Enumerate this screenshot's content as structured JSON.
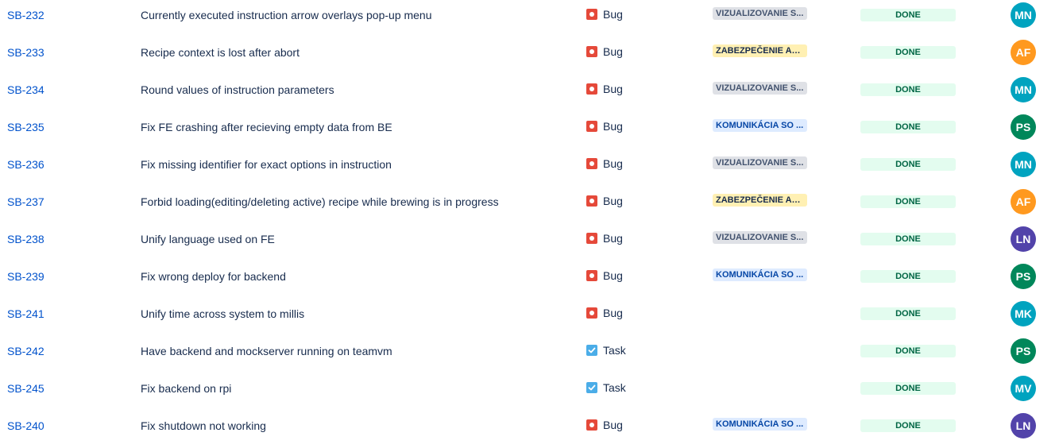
{
  "colors": {
    "MN": "#00a3bf",
    "AF": "#ff991f",
    "PS": "#00875a",
    "LN": "#5243aa",
    "MK": "#00a3bf",
    "MV": "#00a3bf"
  },
  "issues": [
    {
      "key": "SB-232",
      "summary": "Currently executed instruction arrow overlays pop-up menu",
      "type": "Bug",
      "type_icon": "bug-icon",
      "epic": "VIZUALIZOVANIE S...",
      "epic_color": "grey",
      "status": "DONE",
      "assignee": "MN"
    },
    {
      "key": "SB-233",
      "summary": "Recipe context is lost after abort",
      "type": "Bug",
      "type_icon": "bug-icon",
      "epic": "ZABEZPEČENIE AUT...",
      "epic_color": "yellow",
      "status": "DONE",
      "assignee": "AF"
    },
    {
      "key": "SB-234",
      "summary": "Round values of instruction parameters",
      "type": "Bug",
      "type_icon": "bug-icon",
      "epic": "VIZUALIZOVANIE S...",
      "epic_color": "grey",
      "status": "DONE",
      "assignee": "MN"
    },
    {
      "key": "SB-235",
      "summary": "Fix FE crashing after recieving empty data from BE",
      "type": "Bug",
      "type_icon": "bug-icon",
      "epic": "KOMUNIKÁCIA SO ...",
      "epic_color": "blue",
      "status": "DONE",
      "assignee": "PS"
    },
    {
      "key": "SB-236",
      "summary": "Fix missing identifier for exact options in instruction",
      "type": "Bug",
      "type_icon": "bug-icon",
      "epic": "VIZUALIZOVANIE S...",
      "epic_color": "grey",
      "status": "DONE",
      "assignee": "MN"
    },
    {
      "key": "SB-237",
      "summary": "Forbid loading(editing/deleting active) recipe while brewing is in progress",
      "type": "Bug",
      "type_icon": "bug-icon",
      "epic": "ZABEZPEČENIE AUT...",
      "epic_color": "yellow",
      "status": "DONE",
      "assignee": "AF"
    },
    {
      "key": "SB-238",
      "summary": "Unify language used on FE",
      "type": "Bug",
      "type_icon": "bug-icon",
      "epic": "VIZUALIZOVANIE S...",
      "epic_color": "grey",
      "status": "DONE",
      "assignee": "LN"
    },
    {
      "key": "SB-239",
      "summary": "Fix wrong deploy for backend",
      "type": "Bug",
      "type_icon": "bug-icon",
      "epic": "KOMUNIKÁCIA SO ...",
      "epic_color": "blue",
      "status": "DONE",
      "assignee": "PS"
    },
    {
      "key": "SB-241",
      "summary": "Unify time across system to millis",
      "type": "Bug",
      "type_icon": "bug-icon",
      "epic": "",
      "epic_color": "",
      "status": "DONE",
      "assignee": "MK"
    },
    {
      "key": "SB-242",
      "summary": "Have backend and mockserver running on teamvm",
      "type": "Task",
      "type_icon": "task-icon",
      "epic": "",
      "epic_color": "",
      "status": "DONE",
      "assignee": "PS"
    },
    {
      "key": "SB-245",
      "summary": "Fix backend on rpi",
      "type": "Task",
      "type_icon": "task-icon",
      "epic": "",
      "epic_color": "",
      "status": "DONE",
      "assignee": "MV"
    },
    {
      "key": "SB-240",
      "summary": "Fix shutdown not working",
      "type": "Bug",
      "type_icon": "bug-icon",
      "epic": "KOMUNIKÁCIA SO ...",
      "epic_color": "blue",
      "status": "DONE",
      "assignee": "LN"
    }
  ]
}
